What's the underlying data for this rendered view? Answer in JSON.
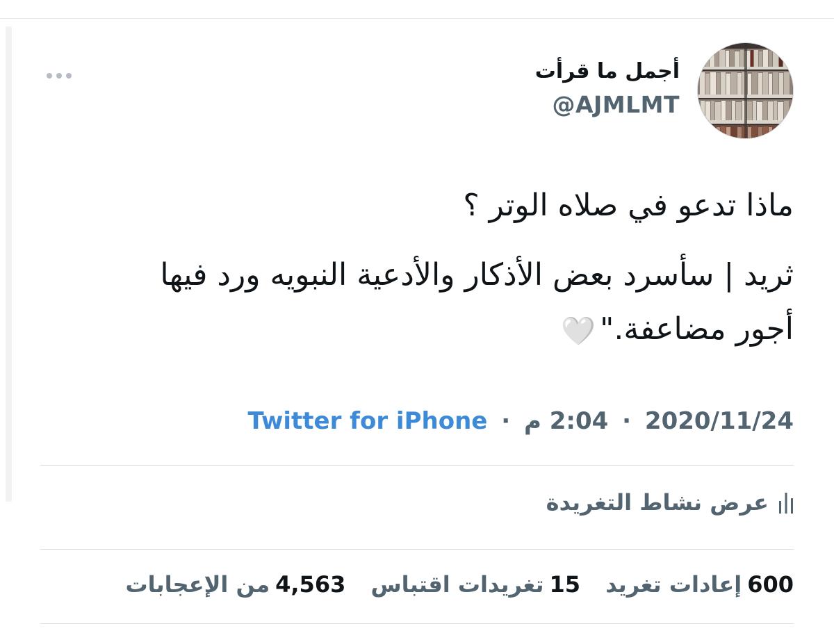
{
  "tweet": {
    "author": {
      "display_name": "أجمل ما قرأت",
      "handle": "@AJMLMT",
      "avatar_icon": "bookshelf-avatar-icon"
    },
    "more_icon": "more-horizontal-icon",
    "text_lines": [
      "ماذا تدعو في صلاه الوتر ؟",
      "ثريد | سأسرد بعض الأذكار والأدعية النبويه ورد فيها",
      "أجور مضاعفة.\""
    ],
    "emoji": "🤍",
    "date": "2020/11/24",
    "time": "2:04 م",
    "source": "Twitter for iPhone",
    "separator": "·",
    "activity": {
      "label": "عرض نشاط التغريدة",
      "icon": "analytics-bars-icon"
    },
    "stats": {
      "retweets": {
        "count": "600",
        "label": "إعادات تغريد"
      },
      "quotes": {
        "count": "15",
        "label": "تغريدات اقتباس"
      },
      "likes": {
        "count": "4,563",
        "label": "من الإعجابات"
      }
    }
  }
}
